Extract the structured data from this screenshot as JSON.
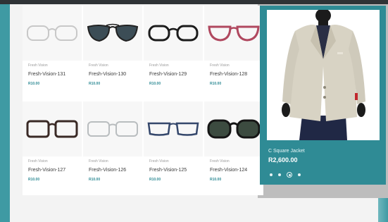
{
  "products": [
    {
      "brand": "Fresh Vision",
      "name": "Fresh-Vision-131",
      "price": "R10.00",
      "style": "clear"
    },
    {
      "brand": "Fresh Vision",
      "name": "Fresh-Vision-130",
      "price": "R10.00",
      "style": "aviator"
    },
    {
      "brand": "Fresh Vision",
      "name": "Fresh-Vision-129",
      "price": "R10.00",
      "style": "black-round"
    },
    {
      "brand": "Fresh Vision",
      "name": "Fresh-Vision-128",
      "price": "R10.00",
      "style": "pink"
    },
    {
      "brand": "Fresh Vision",
      "name": "Fresh-Vision-127",
      "price": "R10.00",
      "style": "brown"
    },
    {
      "brand": "Fresh Vision",
      "name": "Fresh-Vision-126",
      "price": "R10.00",
      "style": "clear-thin"
    },
    {
      "brand": "Fresh Vision",
      "name": "Fresh-Vision-125",
      "price": "R10.00",
      "style": "navy"
    },
    {
      "brand": "Fresh Vision",
      "name": "Fresh-Vision-124",
      "price": "R10.00",
      "style": "sunglasses"
    }
  ],
  "featured": {
    "title": "C Square Jacket",
    "price": "R2,600.00"
  },
  "colors": {
    "accent": "#2f8b95",
    "panel_backdrop": "#bdbdbd",
    "background": "#f3f3f3"
  }
}
